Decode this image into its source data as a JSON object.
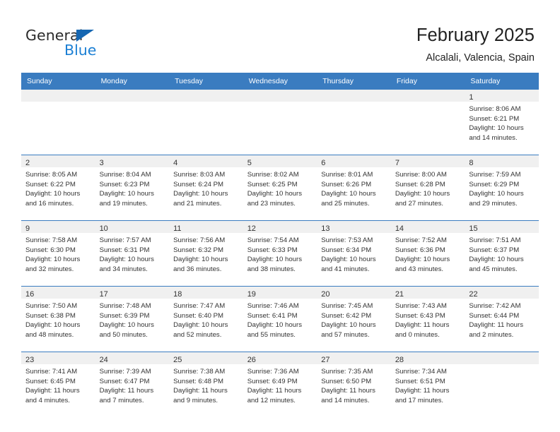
{
  "brand": {
    "name_part1": "General",
    "name_part2": "Blue",
    "primary_color": "#1667b2",
    "accent_color": "#1b7fd4"
  },
  "header": {
    "title": "February 2025",
    "subtitle": "Alcalali, Valencia, Spain"
  },
  "calendar": {
    "header_bg": "#3a7cc0",
    "shaded_bg": "#f0f0f0",
    "weekdays": [
      "Sunday",
      "Monday",
      "Tuesday",
      "Wednesday",
      "Thursday",
      "Friday",
      "Saturday"
    ],
    "weeks": [
      [
        {
          "day": "",
          "lines": []
        },
        {
          "day": "",
          "lines": []
        },
        {
          "day": "",
          "lines": []
        },
        {
          "day": "",
          "lines": []
        },
        {
          "day": "",
          "lines": []
        },
        {
          "day": "",
          "lines": []
        },
        {
          "day": "1",
          "lines": [
            "Sunrise: 8:06 AM",
            "Sunset: 6:21 PM",
            "Daylight: 10 hours",
            "and 14 minutes."
          ]
        }
      ],
      [
        {
          "day": "2",
          "lines": [
            "Sunrise: 8:05 AM",
            "Sunset: 6:22 PM",
            "Daylight: 10 hours",
            "and 16 minutes."
          ]
        },
        {
          "day": "3",
          "lines": [
            "Sunrise: 8:04 AM",
            "Sunset: 6:23 PM",
            "Daylight: 10 hours",
            "and 19 minutes."
          ]
        },
        {
          "day": "4",
          "lines": [
            "Sunrise: 8:03 AM",
            "Sunset: 6:24 PM",
            "Daylight: 10 hours",
            "and 21 minutes."
          ]
        },
        {
          "day": "5",
          "lines": [
            "Sunrise: 8:02 AM",
            "Sunset: 6:25 PM",
            "Daylight: 10 hours",
            "and 23 minutes."
          ]
        },
        {
          "day": "6",
          "lines": [
            "Sunrise: 8:01 AM",
            "Sunset: 6:26 PM",
            "Daylight: 10 hours",
            "and 25 minutes."
          ]
        },
        {
          "day": "7",
          "lines": [
            "Sunrise: 8:00 AM",
            "Sunset: 6:28 PM",
            "Daylight: 10 hours",
            "and 27 minutes."
          ]
        },
        {
          "day": "8",
          "lines": [
            "Sunrise: 7:59 AM",
            "Sunset: 6:29 PM",
            "Daylight: 10 hours",
            "and 29 minutes."
          ]
        }
      ],
      [
        {
          "day": "9",
          "lines": [
            "Sunrise: 7:58 AM",
            "Sunset: 6:30 PM",
            "Daylight: 10 hours",
            "and 32 minutes."
          ]
        },
        {
          "day": "10",
          "lines": [
            "Sunrise: 7:57 AM",
            "Sunset: 6:31 PM",
            "Daylight: 10 hours",
            "and 34 minutes."
          ]
        },
        {
          "day": "11",
          "lines": [
            "Sunrise: 7:56 AM",
            "Sunset: 6:32 PM",
            "Daylight: 10 hours",
            "and 36 minutes."
          ]
        },
        {
          "day": "12",
          "lines": [
            "Sunrise: 7:54 AM",
            "Sunset: 6:33 PM",
            "Daylight: 10 hours",
            "and 38 minutes."
          ]
        },
        {
          "day": "13",
          "lines": [
            "Sunrise: 7:53 AM",
            "Sunset: 6:34 PM",
            "Daylight: 10 hours",
            "and 41 minutes."
          ]
        },
        {
          "day": "14",
          "lines": [
            "Sunrise: 7:52 AM",
            "Sunset: 6:36 PM",
            "Daylight: 10 hours",
            "and 43 minutes."
          ]
        },
        {
          "day": "15",
          "lines": [
            "Sunrise: 7:51 AM",
            "Sunset: 6:37 PM",
            "Daylight: 10 hours",
            "and 45 minutes."
          ]
        }
      ],
      [
        {
          "day": "16",
          "lines": [
            "Sunrise: 7:50 AM",
            "Sunset: 6:38 PM",
            "Daylight: 10 hours",
            "and 48 minutes."
          ]
        },
        {
          "day": "17",
          "lines": [
            "Sunrise: 7:48 AM",
            "Sunset: 6:39 PM",
            "Daylight: 10 hours",
            "and 50 minutes."
          ]
        },
        {
          "day": "18",
          "lines": [
            "Sunrise: 7:47 AM",
            "Sunset: 6:40 PM",
            "Daylight: 10 hours",
            "and 52 minutes."
          ]
        },
        {
          "day": "19",
          "lines": [
            "Sunrise: 7:46 AM",
            "Sunset: 6:41 PM",
            "Daylight: 10 hours",
            "and 55 minutes."
          ]
        },
        {
          "day": "20",
          "lines": [
            "Sunrise: 7:45 AM",
            "Sunset: 6:42 PM",
            "Daylight: 10 hours",
            "and 57 minutes."
          ]
        },
        {
          "day": "21",
          "lines": [
            "Sunrise: 7:43 AM",
            "Sunset: 6:43 PM",
            "Daylight: 11 hours",
            "and 0 minutes."
          ]
        },
        {
          "day": "22",
          "lines": [
            "Sunrise: 7:42 AM",
            "Sunset: 6:44 PM",
            "Daylight: 11 hours",
            "and 2 minutes."
          ]
        }
      ],
      [
        {
          "day": "23",
          "lines": [
            "Sunrise: 7:41 AM",
            "Sunset: 6:45 PM",
            "Daylight: 11 hours",
            "and 4 minutes."
          ]
        },
        {
          "day": "24",
          "lines": [
            "Sunrise: 7:39 AM",
            "Sunset: 6:47 PM",
            "Daylight: 11 hours",
            "and 7 minutes."
          ]
        },
        {
          "day": "25",
          "lines": [
            "Sunrise: 7:38 AM",
            "Sunset: 6:48 PM",
            "Daylight: 11 hours",
            "and 9 minutes."
          ]
        },
        {
          "day": "26",
          "lines": [
            "Sunrise: 7:36 AM",
            "Sunset: 6:49 PM",
            "Daylight: 11 hours",
            "and 12 minutes."
          ]
        },
        {
          "day": "27",
          "lines": [
            "Sunrise: 7:35 AM",
            "Sunset: 6:50 PM",
            "Daylight: 11 hours",
            "and 14 minutes."
          ]
        },
        {
          "day": "28",
          "lines": [
            "Sunrise: 7:34 AM",
            "Sunset: 6:51 PM",
            "Daylight: 11 hours",
            "and 17 minutes."
          ]
        },
        {
          "day": "",
          "lines": []
        }
      ]
    ]
  }
}
